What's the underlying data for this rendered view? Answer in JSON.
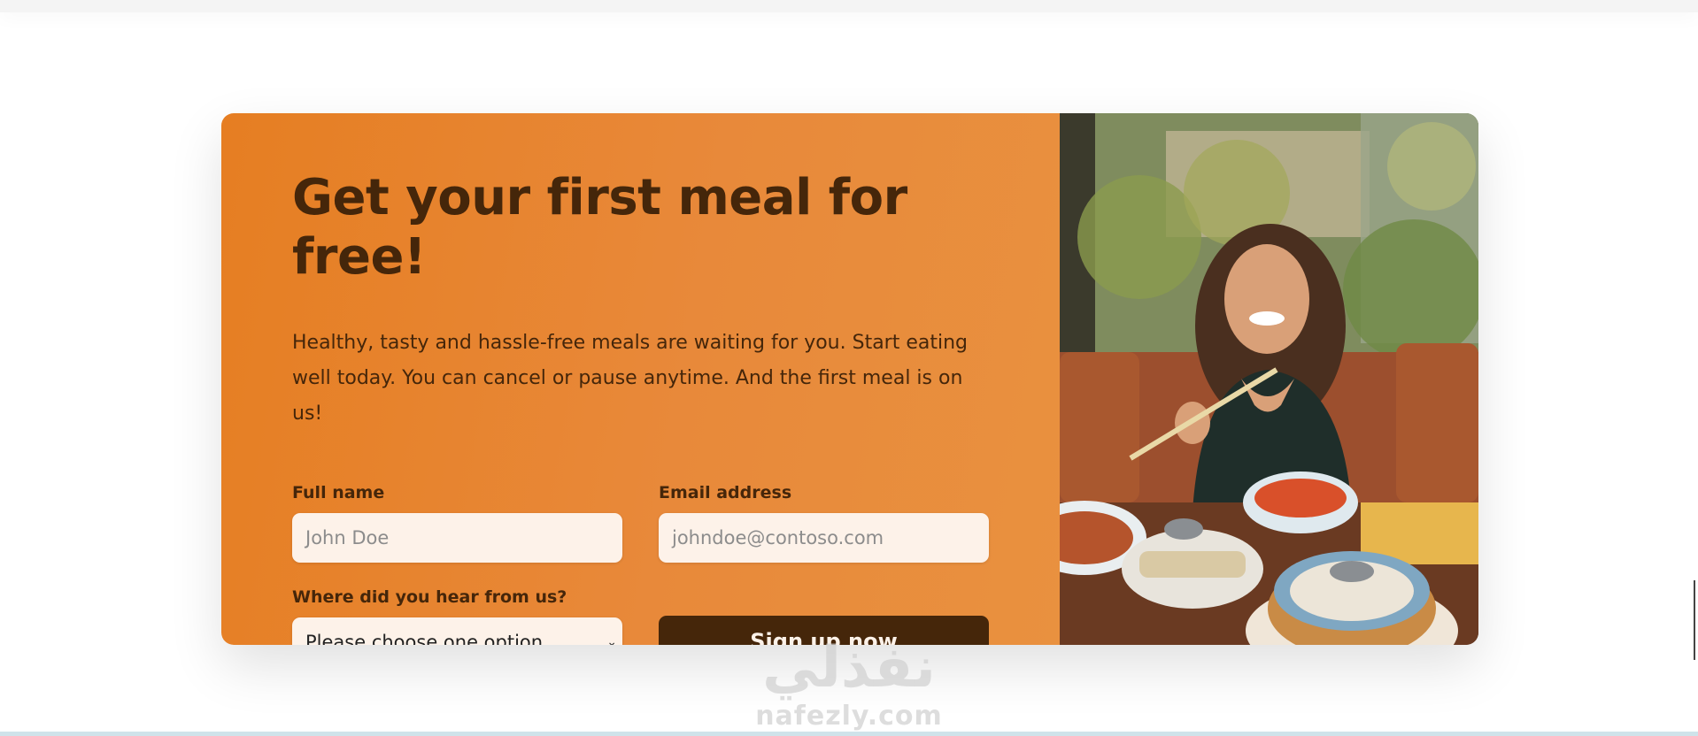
{
  "cta": {
    "title": "Get your first meal for free!",
    "description": "Healthy, tasty and hassle-free meals are waiting for you. Start eating well today. You can cancel or pause anytime. And the first meal is on us!",
    "form": {
      "full_name_label": "Full name",
      "full_name_placeholder": "John Doe",
      "email_label": "Email address",
      "email_placeholder": "johndoe@contoso.com",
      "source_label": "Where did you hear from us?",
      "source_selected": "Please choose one option",
      "submit_label": "Sign up now"
    },
    "image_alt": "Woman smiling while eating a healthy meal at a restaurant"
  },
  "watermark": {
    "arabic": "نفذلي",
    "latin": "nafezly.com"
  },
  "colors": {
    "primary": "#e67e22",
    "dark": "#45260a",
    "field_bg": "#fdf2e9"
  }
}
